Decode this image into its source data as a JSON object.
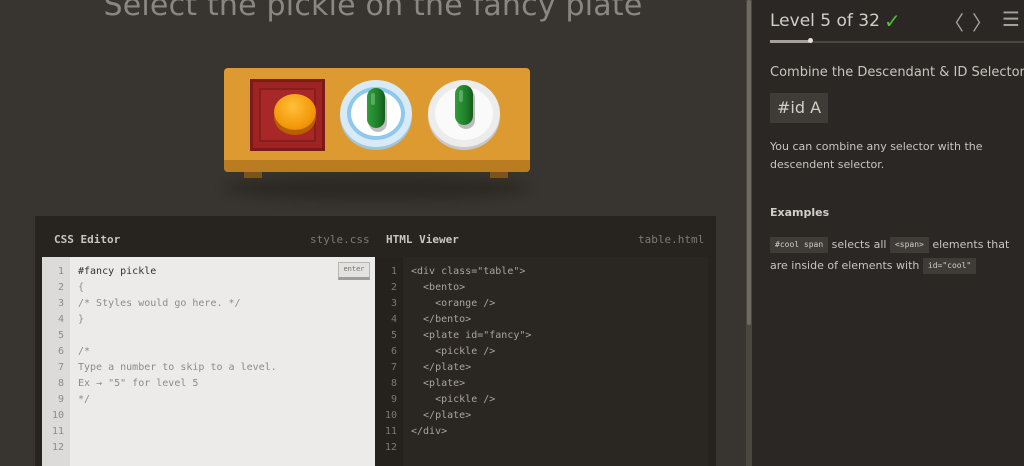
{
  "game": {
    "instruction": "Select the pickle on the fancy plate"
  },
  "css_editor": {
    "title": "CSS Editor",
    "filename": "style.css",
    "enter_label": "enter",
    "lines": [
      "#fancy pickle",
      "{",
      "/* Styles would go here. */",
      "}",
      "",
      "/*",
      "Type a number to skip to a level.",
      "Ex → \"5\" for level 5",
      "*/",
      "",
      "",
      ""
    ],
    "line_numbers": [
      "1",
      "2",
      "3",
      "4",
      "5",
      "6",
      "7",
      "8",
      "9",
      "10",
      "11",
      "12"
    ]
  },
  "html_viewer": {
    "title": "HTML Viewer",
    "filename": "table.html",
    "lines": [
      "<div class=\"table\">",
      "  <bento>",
      "    <orange />",
      "  </bento>",
      "  <plate id=\"fancy\">",
      "    <pickle />",
      "  </plate>",
      "  <plate>",
      "    <pickle />",
      "  </plate>",
      "</div>",
      ""
    ],
    "line_numbers": [
      "1",
      "2",
      "3",
      "4",
      "5",
      "6",
      "7",
      "8",
      "9",
      "10",
      "11",
      "12"
    ]
  },
  "sidebar": {
    "level_text": "Level 5 of 32",
    "check_glyph": "✓",
    "prev_glyph": "〈",
    "next_glyph": "〉",
    "menu_glyph": "☰",
    "progress_fraction": 0.16,
    "subtitle": "Combine the Descendant & ID Selectors",
    "selector_syntax": "#id  A",
    "description": "You can combine any selector with the descendent selector.",
    "examples_heading": "Examples",
    "example": {
      "code1": "#cool span",
      "text1": " selects all ",
      "code2": "<span>",
      "text2": " elements that",
      "text3": "are inside of elements with ",
      "code3": "id=\"cool\""
    }
  },
  "colors": {
    "background": "#38342f",
    "sidebar": "#2a2724",
    "check": "#4fbf3a",
    "table": "#dc9a30",
    "pickle": "#1f7f2a"
  }
}
